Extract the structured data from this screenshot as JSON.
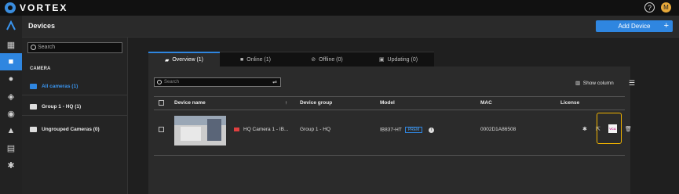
{
  "app": {
    "name": "VORTEX",
    "user_initial": "M",
    "help": "?"
  },
  "header": {
    "title": "Devices",
    "add_button": "Add Device",
    "add_plus": "+"
  },
  "rail": {
    "items": [
      "dashboard-icon",
      "camera-icon",
      "person-icon",
      "tag-icon",
      "account-icon",
      "bell-icon",
      "archive-icon",
      "gear-icon"
    ]
  },
  "left": {
    "search_placeholder": "Search",
    "section_label": "CAMERA",
    "folders": [
      {
        "label": "All cameras (1)",
        "active": true
      },
      {
        "label": "Group 1 - HQ (1)",
        "active": false
      },
      {
        "label": "Ungrouped Cameras (0)",
        "active": false
      }
    ]
  },
  "tabs": [
    {
      "label": "Overview (1)",
      "icon": "camera-icon",
      "active": true
    },
    {
      "label": "Online (1)",
      "icon": "video-icon",
      "active": false
    },
    {
      "label": "Offline (0)",
      "icon": "video-off-icon",
      "active": false
    },
    {
      "label": "Updating (0)",
      "icon": "update-icon",
      "active": false
    }
  ],
  "panel": {
    "search_placeholder": "Search",
    "show_column": "Show column",
    "columns": {
      "name": "Device name",
      "sort": "↑",
      "group": "Device group",
      "model": "Model",
      "mac": "MAC",
      "license": "License"
    },
    "row": {
      "name": "HQ Camera 1 - IB...",
      "group": "Group 1 - HQ",
      "model": "IB837-HT",
      "model_badge": "PREM",
      "mac": "0002D1A86508",
      "vca": "VCA"
    }
  },
  "colors": {
    "accent": "#2f86e0",
    "highlight": "#f2b400"
  }
}
